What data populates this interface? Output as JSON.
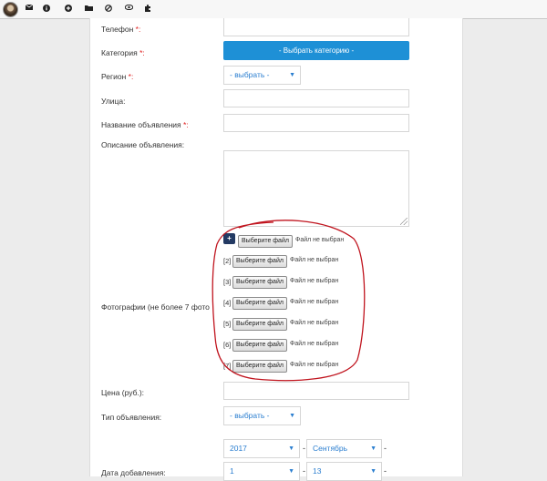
{
  "toolbar": {
    "icons": [
      "avatar",
      "mail-icon",
      "info-icon",
      "plus-circle-icon",
      "folder-icon",
      "block-icon",
      "eye-icon",
      "puzzle-icon"
    ]
  },
  "form": {
    "phone_label": "Телефон",
    "required_mark": "*:",
    "category_label": "Категория",
    "category_button": "- Выбрать категорию -",
    "region_label": "Регион",
    "region_select": "- выбрать -",
    "street_label": "Улица:",
    "title_label": "Название объявления",
    "description_label": "Описание объявления:",
    "photos_label": "Фотографии (не более 7 фото",
    "file_button": "Выберите файл",
    "no_file": "Файл не выбран",
    "add_photo": "+",
    "photo_numbers": [
      "[2]",
      "[3]",
      "[4]",
      "[5]",
      "[6]",
      "[7]"
    ],
    "price_label": "Цена (руб.):",
    "ad_type_label": "Тип объявления:",
    "ad_type_select": "- выбрать -",
    "date_label": "Дата добавления:",
    "year_select": "2017",
    "month_select": "Сентябрь",
    "day_select": "1",
    "day2_select": "13",
    "dash": "-"
  },
  "annotation_color": "#c0141e",
  "accent_color": "#1e90d6"
}
